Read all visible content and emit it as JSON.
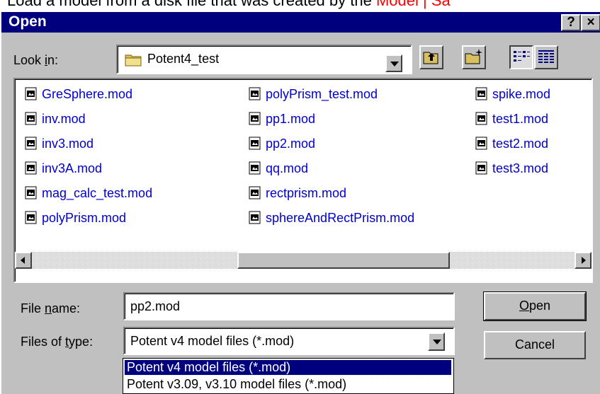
{
  "background": {
    "text_prefix": "Load a model from a disk file that was created by the ",
    "text_link": "Model | Sa"
  },
  "dialog": {
    "title": "Open",
    "help_button": "?",
    "close_button": "×"
  },
  "look_in": {
    "label_pre": "Look ",
    "label_u": "i",
    "label_post": "n:",
    "value": "Potent4_test"
  },
  "toolbar_icons": [
    "up-one-level-icon",
    "create-new-folder-icon",
    "list-view-icon",
    "details-view-icon"
  ],
  "files": [
    {
      "name": "GreSphere.mod",
      "col": 0,
      "row": 0
    },
    {
      "name": "inv.mod",
      "col": 0,
      "row": 1
    },
    {
      "name": "inv3.mod",
      "col": 0,
      "row": 2
    },
    {
      "name": "inv3A.mod",
      "col": 0,
      "row": 3
    },
    {
      "name": "mag_calc_test.mod",
      "col": 0,
      "row": 4
    },
    {
      "name": "polyPrism.mod",
      "col": 0,
      "row": 5
    },
    {
      "name": "polyPrism_test.mod",
      "col": 1,
      "row": 0
    },
    {
      "name": "pp1.mod",
      "col": 1,
      "row": 1
    },
    {
      "name": "pp2.mod",
      "col": 1,
      "row": 2
    },
    {
      "name": "qq.mod",
      "col": 1,
      "row": 3
    },
    {
      "name": "rectprism.mod",
      "col": 1,
      "row": 4
    },
    {
      "name": "sphereAndRectPrism.mod",
      "col": 1,
      "row": 5
    },
    {
      "name": "spike.mod",
      "col": 2,
      "row": 0
    },
    {
      "name": "test1.mod",
      "col": 2,
      "row": 1
    },
    {
      "name": "test2.mod",
      "col": 2,
      "row": 2
    },
    {
      "name": "test3.mod",
      "col": 2,
      "row": 3
    }
  ],
  "file_name": {
    "label_pre": "File ",
    "label_u": "n",
    "label_post": "ame:",
    "value": "pp2.mod"
  },
  "file_type": {
    "label_pre": "Files of ",
    "label_u": "t",
    "label_post": "ype:",
    "value": "Potent v4 model files (*.mod)",
    "options": [
      "Potent v4 model files (*.mod)",
      "Potent v3.09, v3.10 model files (*.mod)"
    ]
  },
  "buttons": {
    "open_u": "O",
    "open_rest": "pen",
    "cancel": "Cancel"
  },
  "colors": {
    "titlebar": "#00007f",
    "dialog": "#c0c0c0",
    "file_text": "#0000cc",
    "link_text": "#ff0000"
  }
}
